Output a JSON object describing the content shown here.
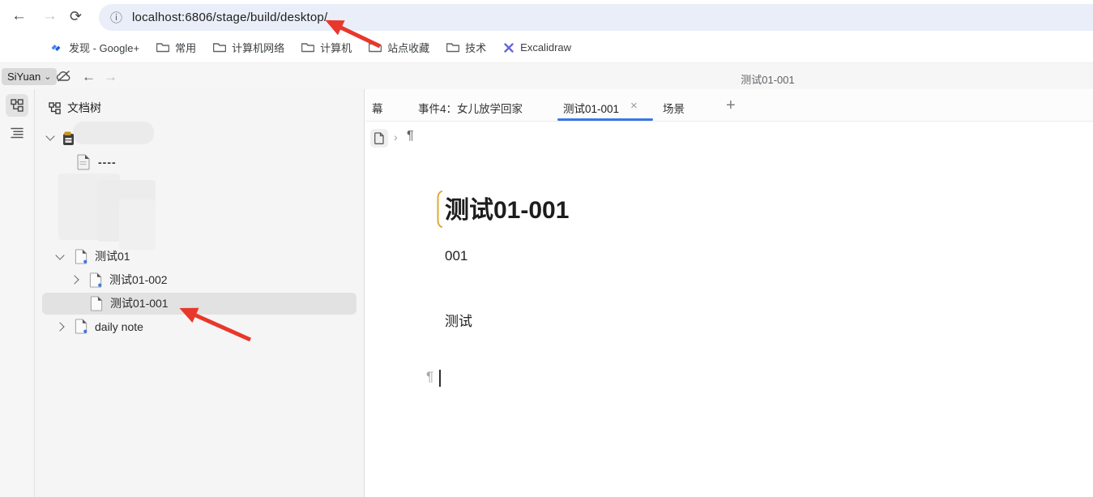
{
  "browser": {
    "url": "localhost:6806/stage/build/desktop/",
    "bookmarks": [
      {
        "label": "发现 - Google+"
      },
      {
        "label": "常用"
      },
      {
        "label": "计算机网络"
      },
      {
        "label": "计算机"
      },
      {
        "label": "站点收藏"
      },
      {
        "label": "技术"
      },
      {
        "label": "Excalidraw"
      }
    ]
  },
  "app": {
    "menu_label": "SiYuan",
    "window_title": "测试01-001"
  },
  "sidebar": {
    "header": "文档树",
    "tree": [
      {
        "type": "notebook",
        "redacted": true,
        "expanded": true
      },
      {
        "type": "doc",
        "label": "----"
      },
      {
        "type": "doc",
        "label": "测试01",
        "expanded": true
      },
      {
        "type": "doc",
        "label": "测试01-002",
        "collapsed": true
      },
      {
        "type": "doc",
        "label": "测试01-001",
        "selected": true
      },
      {
        "type": "doc",
        "label": "daily note",
        "collapsed": true
      }
    ]
  },
  "tabs": [
    {
      "label": "幕"
    },
    {
      "label": "事件4：女儿放学回家"
    },
    {
      "label": "测试01-001",
      "active": true,
      "closable": true
    },
    {
      "label": "场景"
    }
  ],
  "editor": {
    "doc_title": "测试01-001",
    "blocks": [
      "001",
      "测试"
    ]
  },
  "icons": {
    "back_arrow": "←",
    "forward_arrow": "→",
    "reload": "⟳",
    "info": "ⓘ",
    "menu_chevron": "⌄",
    "close": "×",
    "add": "+",
    "pilcrow": "¶",
    "breadcrumb_chevron": "›"
  },
  "colors": {
    "accent_blue": "#3b76e8",
    "annotation_red": "#e8382b",
    "title_marker_amber": "#ddab33",
    "url_bar_bg": "#e9eef9"
  }
}
